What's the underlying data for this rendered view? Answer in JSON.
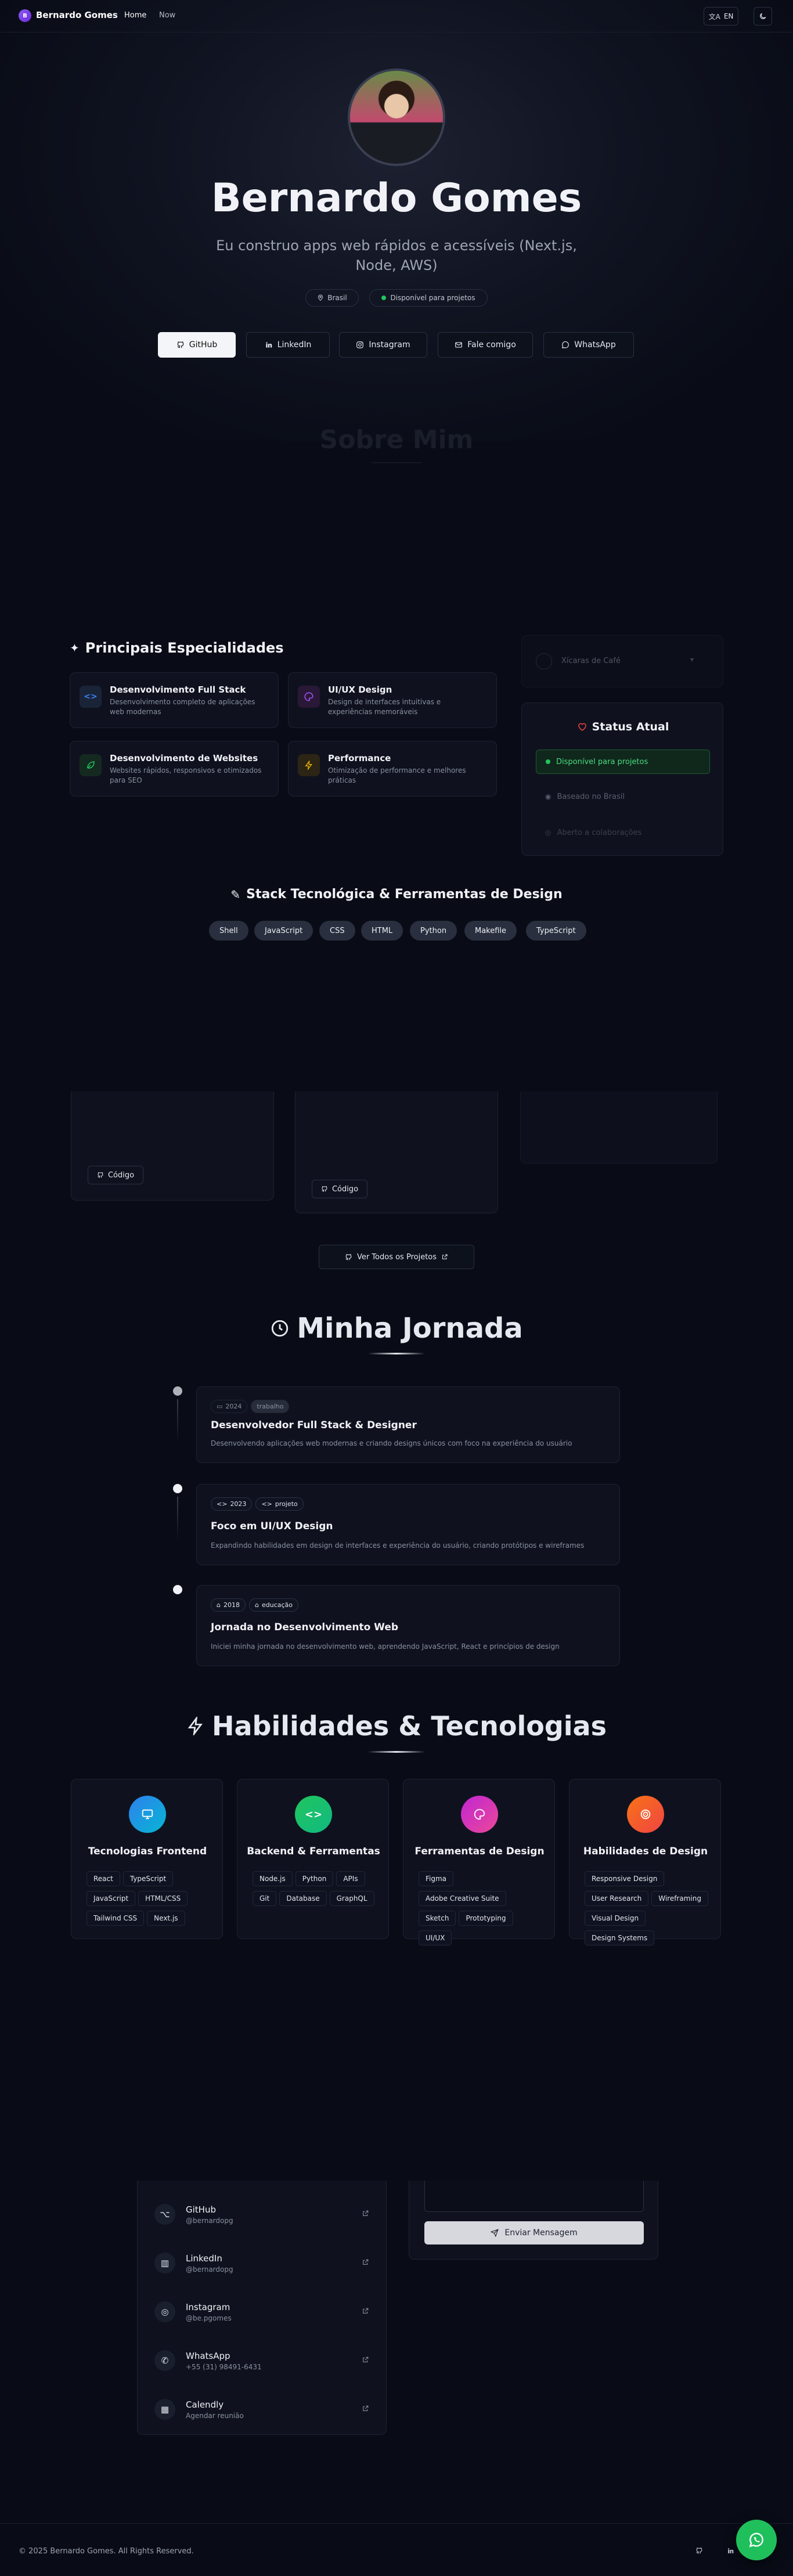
{
  "nav": {
    "brand": "Bernardo Gomes",
    "links": [
      "Home",
      "Now"
    ],
    "lang": "EN"
  },
  "hero": {
    "name": "Bernardo Gomes",
    "tagline": "Eu construo apps web rápidos e acessíveis (Next.js, Node, AWS)",
    "badges": [
      "Brasil",
      "Disponível para projetos"
    ],
    "buttons": [
      "GitHub",
      "LinkedIn",
      "Instagram",
      "Fale comigo",
      "WhatsApp"
    ]
  },
  "about": {
    "title": "Sobre Mim"
  },
  "specialties": {
    "title": "Principais Especialidades",
    "items": [
      {
        "title": "Desenvolvimento Full Stack",
        "desc": "Desenvolvimento completo de aplicações web modernas"
      },
      {
        "title": "UI/UX Design",
        "desc": "Design de interfaces intuitivas e experiências memoráveis"
      },
      {
        "title": "Desenvolvimento de Websites",
        "desc": "Websites rápidos, responsivos e otimizados para SEO"
      },
      {
        "title": "Performance",
        "desc": "Otimização de performance e melhores práticas"
      }
    ]
  },
  "status": {
    "coffee": "Xícaras de Café",
    "title": "Status Atual",
    "items": [
      "Disponível para projetos",
      "Baseado no Brasil",
      "Aberto a colaborações"
    ]
  },
  "stack": {
    "title": "Stack Tecnológica & Ferramentas de Design",
    "chips": [
      "Shell",
      "JavaScript",
      "CSS",
      "HTML",
      "Python",
      "Makefile",
      "TypeScript"
    ]
  },
  "projects": {
    "code_label": "Código",
    "view_all": "Ver Todos os Projetos"
  },
  "journey": {
    "title": "Minha Jornada",
    "items": [
      {
        "year": "2024",
        "kind": "trabalho",
        "title": "Desenvolvedor Full Stack & Designer",
        "desc": "Desenvolvendo aplicações web modernas e criando designs únicos com foco na experiência do usuário"
      },
      {
        "year": "2023",
        "kind": "projeto",
        "title": "Foco em UI/UX Design",
        "desc": "Expandindo habilidades em design de interfaces e experiência do usuário, criando protótipos e wireframes"
      },
      {
        "year": "2018",
        "kind": "educação",
        "title": "Jornada no Desenvolvimento Web",
        "desc": "Iniciei minha jornada no desenvolvimento web, aprendendo JavaScript, React e princípios de design"
      }
    ]
  },
  "skills": {
    "title": "Habilidades & Tecnologias",
    "groups": [
      {
        "title": "Tecnologias Frontend",
        "color": "#2f80ed",
        "tags": [
          "React",
          "TypeScript",
          "JavaScript",
          "HTML/CSS",
          "Tailwind CSS",
          "Next.js"
        ]
      },
      {
        "title": "Backend & Ferramentas",
        "color": "#22c55e",
        "tags": [
          "Node.js",
          "Python",
          "APIs",
          "Git",
          "Database",
          "GraphQL"
        ]
      },
      {
        "title": "Ferramentas de Design",
        "color": "#c026d3",
        "tags": [
          "Figma",
          "Adobe Creative Suite",
          "Sketch",
          "Prototyping",
          "UI/UX"
        ]
      },
      {
        "title": "Habilidades de Design",
        "color": "#f05a28",
        "tags": [
          "Responsive Design",
          "User Research",
          "Wireframing",
          "Visual Design",
          "Design Systems"
        ]
      }
    ]
  },
  "contact": {
    "links": [
      {
        "name": "GitHub",
        "handle": "@bernardopg"
      },
      {
        "name": "LinkedIn",
        "handle": "@bernardopg"
      },
      {
        "name": "Instagram",
        "handle": "@be.pgomes"
      },
      {
        "name": "WhatsApp",
        "handle": "+55 (31) 98491-6431"
      },
      {
        "name": "Calendly",
        "handle": "Agendar reunião"
      }
    ],
    "send": "Enviar Mensagem"
  },
  "footer": {
    "copyright": "© 2025 Bernardo Gomes. All Rights Reserved."
  },
  "colors": {
    "accent_green": "#22c55e",
    "whatsapp": "#1fbf5c",
    "heart": "#ef4444"
  }
}
